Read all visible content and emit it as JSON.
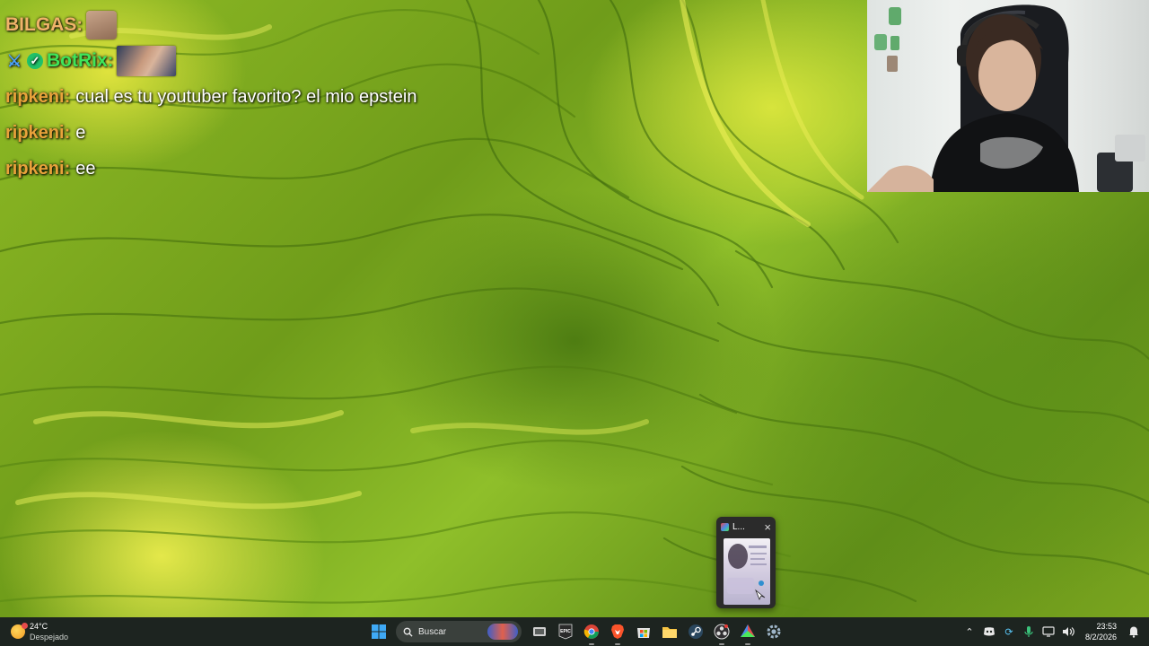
{
  "chat": {
    "messages": [
      {
        "user": "BILGAS",
        "user_color": "#f0b36a",
        "text": "",
        "emote": "cat-emote"
      },
      {
        "user": "BotRix",
        "user_color": "#3ee55a",
        "text": "",
        "emote": "face-emote",
        "badges": [
          "sword-icon",
          "verified-icon"
        ]
      },
      {
        "user": "ripkeni",
        "user_color": "#e9a23b",
        "text": "cual es tu youtuber favorito? el mio epstein"
      },
      {
        "user": "ripkeni",
        "user_color": "#e9a23b",
        "text": "e"
      },
      {
        "user": "ripkeni",
        "user_color": "#e9a23b",
        "text": "ee"
      }
    ]
  },
  "preview": {
    "title": "L...",
    "close_icon": "close-icon"
  },
  "taskbar": {
    "weather": {
      "temp": "24°C",
      "desc": "Despejado"
    },
    "search": {
      "label": "Buscar"
    },
    "apps": [
      "start-icon",
      "search-icon",
      "file-explorer-icon",
      "epic-games-icon",
      "chrome-icon",
      "brave-icon",
      "microsoft-store-icon",
      "folder-icon",
      "steam-icon",
      "obs-icon",
      "kick-icon",
      "settings-icon"
    ],
    "clock": {
      "time": "23:53",
      "date": "8/2/2026"
    }
  },
  "colors": {
    "taskbar_bg": "#1d2420",
    "botrix_name": "#3ee55a",
    "ripkeni_name": "#e9a23b",
    "bilgas_name": "#f0b36a"
  }
}
